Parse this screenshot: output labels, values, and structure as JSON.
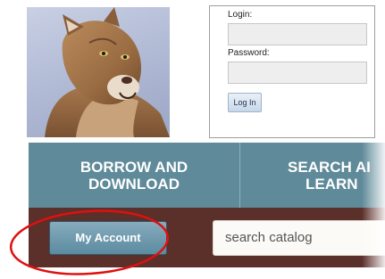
{
  "login": {
    "login_label": "Login:",
    "password_label": "Password:",
    "button_label": "Log In"
  },
  "nav": {
    "borrow_line1": "BORROW AND",
    "borrow_line2": "DOWNLOAD",
    "search_line1": "SEARCH AI",
    "search_line2": "LEARN"
  },
  "account": {
    "button_label": "My Account",
    "search_placeholder": "search catalog"
  },
  "colors": {
    "nav_band": "#5f8a99",
    "account_band": "#5b2f2a",
    "highlight": "#e01010"
  }
}
